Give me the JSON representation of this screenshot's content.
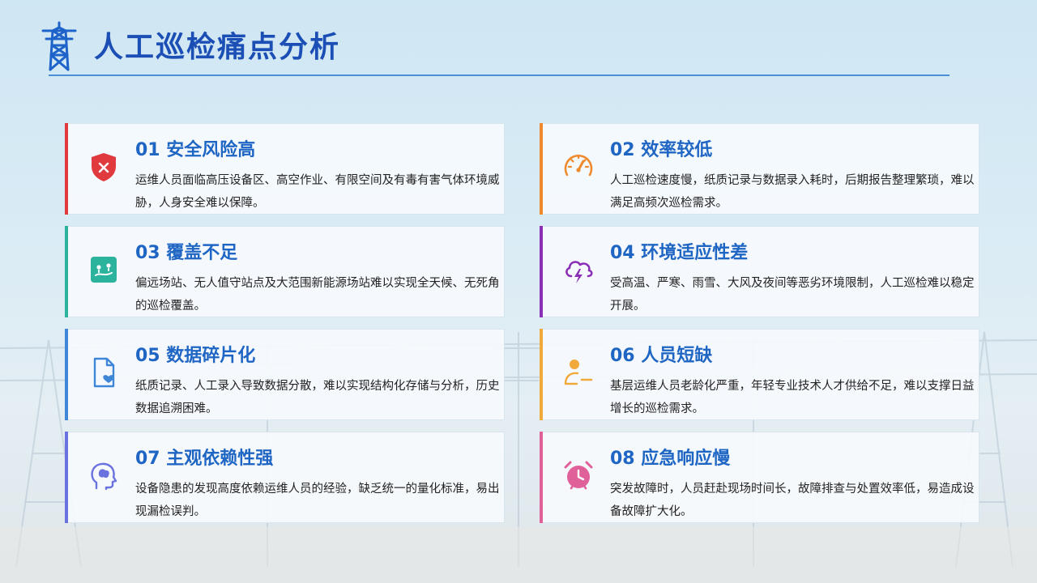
{
  "header": {
    "title": "人工巡检痛点分析"
  },
  "colors": {
    "title": "#1b4fb5",
    "card_title": "#1f66c4",
    "accents": [
      "#e03a3f",
      "#ee8a2d",
      "#2bb39d",
      "#8a2fb6",
      "#3f86d8",
      "#f2a93b",
      "#6a72e0",
      "#e0609a"
    ]
  },
  "cards": [
    {
      "title": "01 安全风险高",
      "icon": "shield-x-icon",
      "desc": "运维人员面临高压设备区、高空作业、有限空间及有毒有害气体环境威胁，人身安全难以保障。"
    },
    {
      "title": "02 效率较低",
      "icon": "speedometer-icon",
      "desc": "人工巡检速度慢，纸质记录与数据录入耗时，后期报告整理繁琐，难以满足高频次巡检需求。"
    },
    {
      "title": "03 覆盖不足",
      "icon": "map-pins-icon",
      "desc": "偏远场站、无人值守站点及大范围新能源场站难以实现全天候、无死角的巡检覆盖。"
    },
    {
      "title": "04 环境适应性差",
      "icon": "storm-cloud-icon",
      "desc": "受高温、严寒、雨雪、大风及夜间等恶劣环境限制，人工巡检难以稳定开展。"
    },
    {
      "title": "05 数据碎片化",
      "icon": "document-heart-icon",
      "desc": "纸质记录、人工录入导致数据分散，难以实现结构化存储与分析，历史数据追溯困难。"
    },
    {
      "title": "06 人员短缺",
      "icon": "user-minus-icon",
      "desc": "基层运维人员老龄化严重，年轻专业技术人才供给不足，难以支撑日益增长的巡检需求。"
    },
    {
      "title": "07 主观依赖性强",
      "icon": "head-thought-icon",
      "desc": "设备隐患的发现高度依赖运维人员的经验，缺乏统一的量化标准，易出现漏检误判。"
    },
    {
      "title": "08 应急响应慢",
      "icon": "alarm-clock-icon",
      "desc": "突发故障时，人员赶赴现场时间长，故障排查与处置效率低，易造成设备故障扩大化。"
    }
  ]
}
